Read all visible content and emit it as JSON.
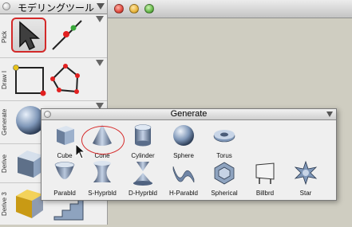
{
  "palette": {
    "title": "モデリングツール",
    "sections": [
      {
        "label": "Pick"
      },
      {
        "label": "Draw I"
      },
      {
        "label": "Generate"
      },
      {
        "label": "Derive"
      },
      {
        "label": "Derive 3"
      }
    ]
  },
  "generate": {
    "title": "Generate",
    "row1": [
      "Cube",
      "Cone",
      "Cylinder",
      "Sphere",
      "Torus"
    ],
    "row2": [
      "Parabld",
      "S-Hyprbld",
      "D-Hyprbld",
      "H-Parabld",
      "Spherical",
      "Billbrd",
      "Star"
    ]
  },
  "colors": {
    "highlight": "#d62a2a",
    "close": "#e04a3f",
    "minimize": "#e8b53c",
    "zoom": "#67b84a"
  }
}
